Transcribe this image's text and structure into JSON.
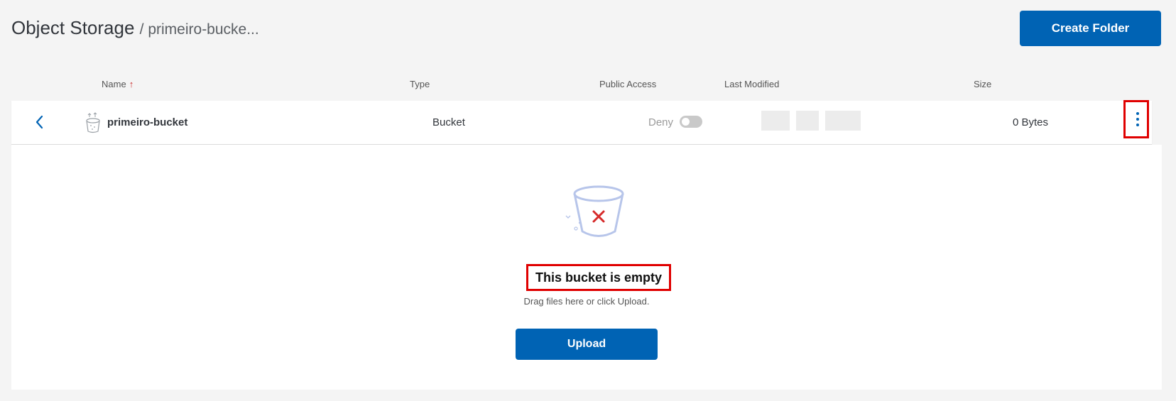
{
  "header": {
    "title": "Object Storage",
    "breadcrumb": "/ primeiro-bucke...",
    "create_folder_label": "Create Folder"
  },
  "table": {
    "columns": {
      "name": "Name",
      "type": "Type",
      "public_access": "Public Access",
      "last_modified": "Last Modified",
      "size": "Size"
    },
    "sort": {
      "column": "name",
      "direction": "ascending",
      "indicator": "↑"
    },
    "row": {
      "name": "primeiro-bucket",
      "type": "Bucket",
      "public_access_label": "Deny",
      "public_access_enabled": false,
      "last_modified": "",
      "size": "0 Bytes",
      "icon": "bucket-icon",
      "back_icon": "chevron-left-icon",
      "menu_icon": "kebab-menu-icon"
    }
  },
  "empty_state": {
    "title": "This bucket is empty",
    "subtitle": "Drag files here or click Upload.",
    "upload_label": "Upload",
    "icon": "empty-bucket-icon"
  },
  "colors": {
    "primary": "#0063b4",
    "highlight": "#e00000",
    "sort_arrow": "#c92a2a",
    "background": "#f4f4f4"
  }
}
